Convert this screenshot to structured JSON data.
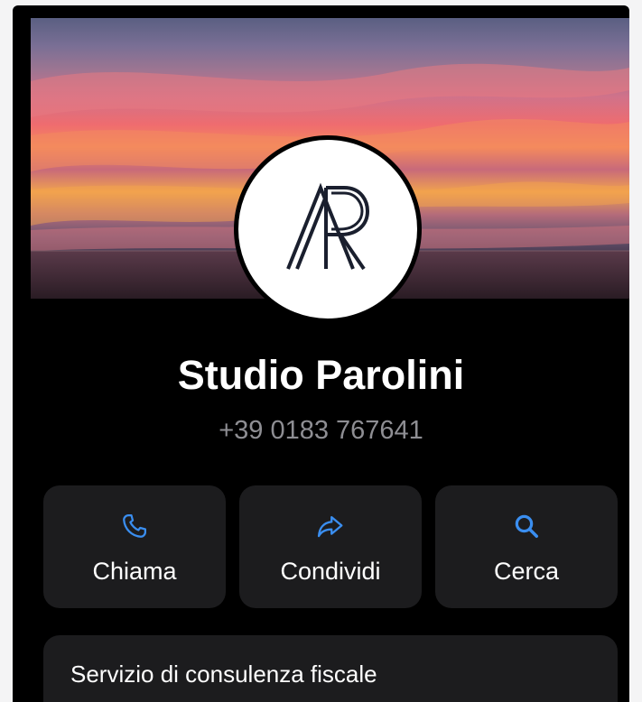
{
  "business": {
    "name": "Studio Parolini",
    "phone": "+39 0183 767641",
    "logo_text": "AP"
  },
  "actions": [
    {
      "label": "Chiama",
      "icon": "phone-icon"
    },
    {
      "label": "Condividi",
      "icon": "share-arrow-icon"
    },
    {
      "label": "Cerca",
      "icon": "search-icon"
    }
  ],
  "service": {
    "label": "Servizio di consulenza fiscale"
  },
  "colors": {
    "background": "#000000",
    "card": "#1c1c1e",
    "accent": "#3a8ef0",
    "secondary_text": "#8e8e93",
    "primary_text": "#ffffff"
  }
}
